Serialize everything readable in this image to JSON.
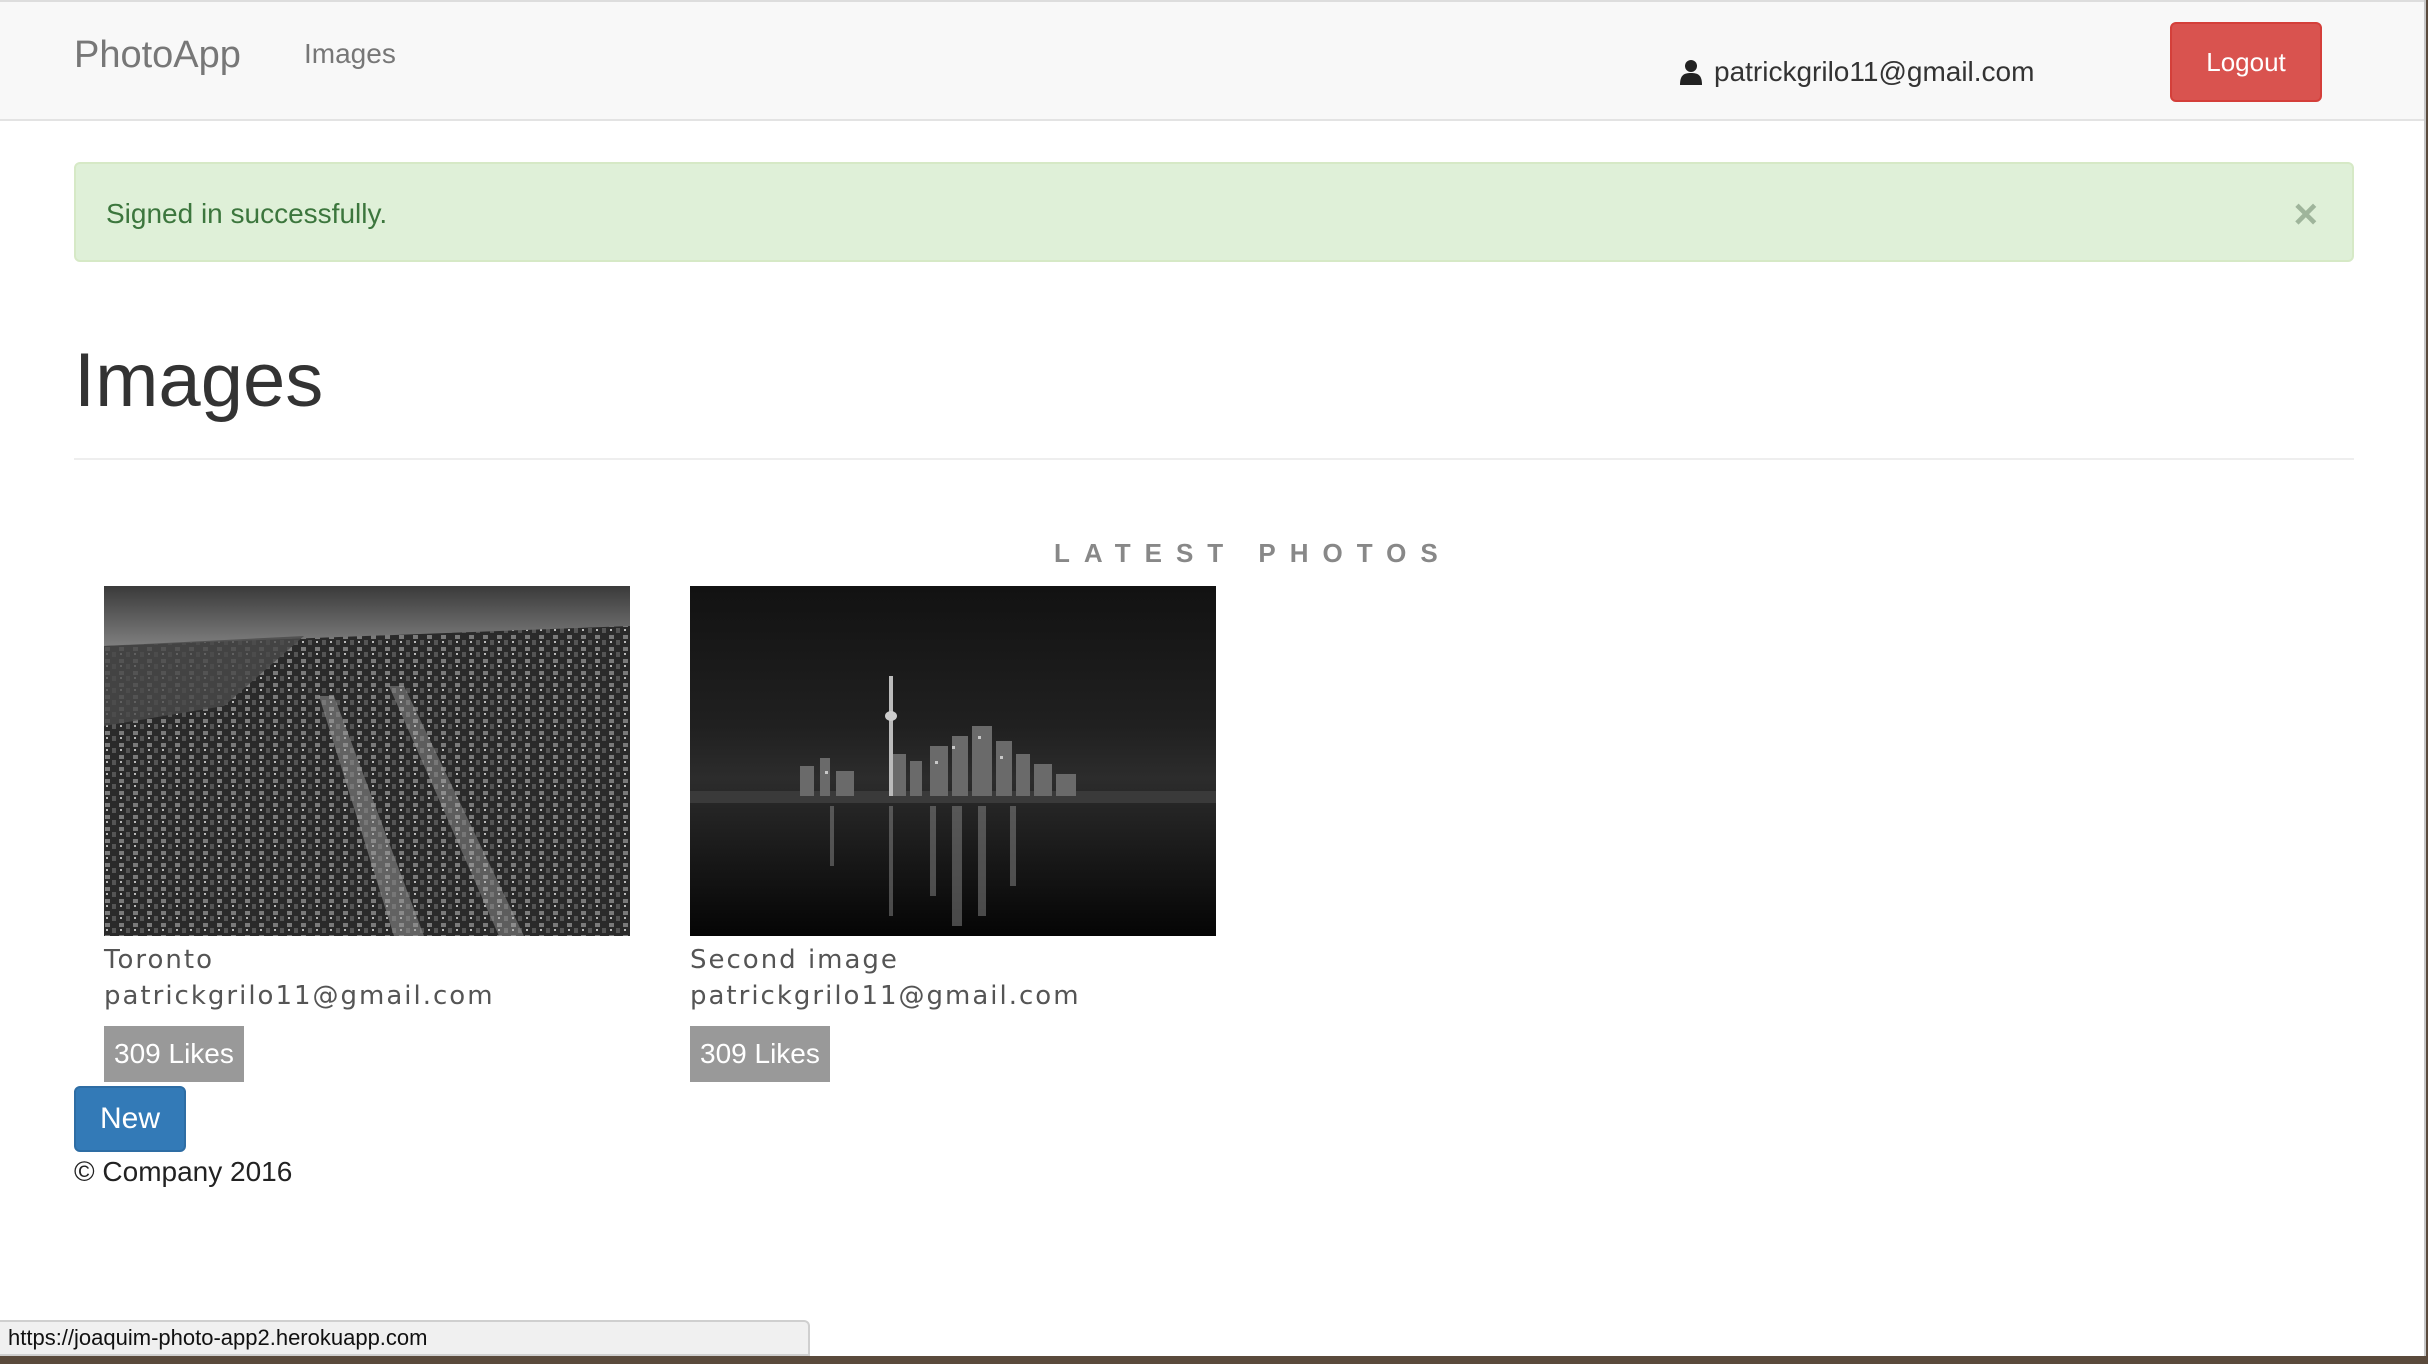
{
  "navbar": {
    "brand": "PhotoApp",
    "images_link": "Images",
    "user_email": "patrickgrilo11@gmail.com",
    "logout_label": "Logout"
  },
  "alert": {
    "message": "Signed in successfully.",
    "close_symbol": "×"
  },
  "page": {
    "title": "Images",
    "section_title": "LATEST PHOTOS"
  },
  "images": [
    {
      "caption": "Toronto",
      "author": "patrickgrilo11@gmail.com",
      "likes": "309 Likes"
    },
    {
      "caption": "Second image",
      "author": "patrickgrilo11@gmail.com",
      "likes": "309 Likes"
    }
  ],
  "actions": {
    "new_label": "New"
  },
  "footer": {
    "text": "© Company 2016"
  },
  "status_bar": {
    "url": "https://joaquim-photo-app2.herokuapp.com"
  },
  "colors": {
    "logout": "#d9534f",
    "primary": "#337ab7",
    "alert_bg": "#dff0d8",
    "alert_text": "#3c763d",
    "likes_badge": "#999999"
  }
}
